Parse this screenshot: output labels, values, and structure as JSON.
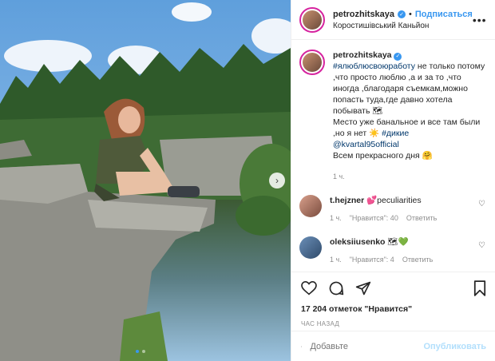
{
  "header": {
    "username": "petrozhitskaya",
    "follow_label": "Подписаться",
    "location": "Коростишівський Каньйон",
    "separator": "•",
    "more_icon": "more-dots-icon"
  },
  "caption": {
    "username": "petrozhitskaya",
    "hashtag": "#ялюблюсвоюработу",
    "text": " не только потому ,что просто люблю ,а и за то ,что иногда ,благодаря съемкам,можно попасть туда,где давно хотела побывать 🗺",
    "text2": "Место уже банальное и все там были ,но я нет ☀️",
    "hashtag2": "#дикие",
    "mention": "@kvartal95official",
    "text3": "Всем прекрасного дня 🤗",
    "time": "1 ч."
  },
  "comments": [
    {
      "username": "t.hejzner",
      "text": "💕peculiarities",
      "time": "1 ч.",
      "likes": "\"Нравится\": 40",
      "reply": "Ответить"
    },
    {
      "username": "oleksiiusenko",
      "text": "🗺💚",
      "time": "1 ч.",
      "likes": "\"Нравится\": 4",
      "reply": "Ответить"
    }
  ],
  "actions": {
    "likes_text": "17 204 отметок \"Нравится\"",
    "time_ago": "ЧАС НАЗАД"
  },
  "add_comment": {
    "placeholder": "Добавьте",
    "publish_label": "Опубликовать"
  },
  "colors": {
    "link": "#3897f0",
    "tag": "#00376b",
    "muted": "#8e8e8e"
  }
}
